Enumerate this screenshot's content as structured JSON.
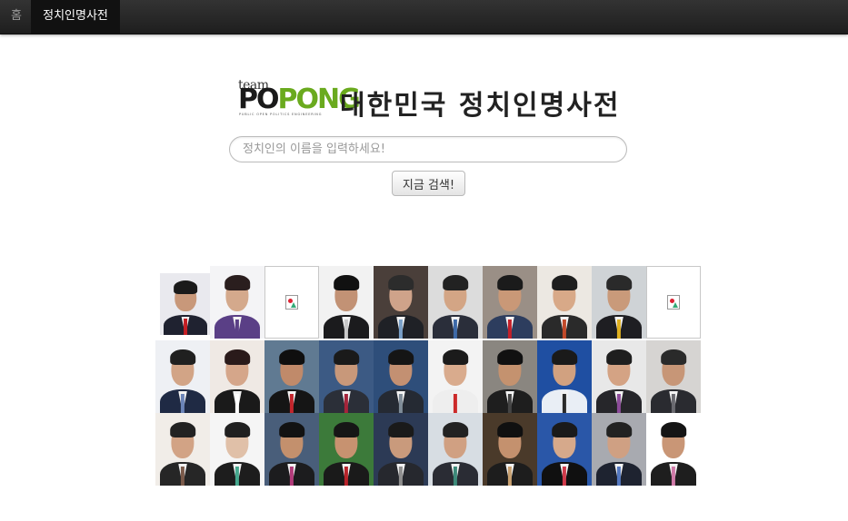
{
  "navbar": {
    "home_label": "홈",
    "active_label": "정치인명사전"
  },
  "brand": {
    "logo_team": "team",
    "logo_po": "PO",
    "logo_pong": "PONG",
    "logo_tagline": "PUBLIC OPEN POLITICS ENGINEERING",
    "title": "대한민국 정치인명사전"
  },
  "search": {
    "placeholder": "정치인의 이름을 입력하세요!",
    "value": "",
    "button_label": "지금 검색!"
  },
  "colors": {
    "navbar": "#222222",
    "logo_green": "#6aaa1e"
  },
  "photos": [
    {
      "bg": "#e9e9ee",
      "suit": "#1f2230",
      "tie": "#c41e24",
      "skin": "#c8987a",
      "hair": "#1a1a1a",
      "broken": false
    },
    {
      "bg": "#f4f4f6",
      "suit": "#5a3f86",
      "tie": "#5a3f86",
      "skin": "#d4a98c",
      "hair": "#2a1e1e",
      "broken": false
    },
    {
      "bg": "#ffffff",
      "suit": "",
      "tie": "",
      "skin": "",
      "hair": "",
      "broken": true
    },
    {
      "bg": "#f2f2f2",
      "suit": "#1b1b1d",
      "tie": "#c9c9c9",
      "skin": "#c29275",
      "hair": "#111111",
      "broken": false
    },
    {
      "bg": "#4a3f3a",
      "suit": "#1f2126",
      "tie": "#7aa0c8",
      "skin": "#cfa38a",
      "hair": "#2c2c2c",
      "broken": false
    },
    {
      "bg": "#dcdcdc",
      "suit": "#2a2e3a",
      "tie": "#3e6aa8",
      "skin": "#d3a585",
      "hair": "#222222",
      "broken": false
    },
    {
      "bg": "#9a8f86",
      "suit": "#2d3d5e",
      "tie": "#c4202a",
      "skin": "#c99877",
      "hair": "#1b1b1b",
      "broken": false
    },
    {
      "bg": "#ece8e2",
      "suit": "#2a2a2a",
      "tie": "#c24a2a",
      "skin": "#d8a988",
      "hair": "#1e1e1e",
      "broken": false
    },
    {
      "bg": "#cfd3d6",
      "suit": "#1e1e22",
      "tie": "#e0b11f",
      "skin": "#c99a7a",
      "hair": "#2a2a2a",
      "broken": false
    },
    {
      "bg": "#ffffff",
      "suit": "",
      "tie": "",
      "skin": "",
      "hair": "",
      "broken": true
    },
    {
      "bg": "#eef0f4",
      "suit": "#1f2a44",
      "tie": "#6b84b8",
      "skin": "#d2a486",
      "hair": "#202020",
      "broken": false
    },
    {
      "bg": "#efe9e4",
      "suit": "#1a1a1a",
      "tie": "#ffffff",
      "skin": "#d5a68a",
      "hair": "#2a1a1a",
      "broken": false
    },
    {
      "bg": "#607a92",
      "suit": "#151515",
      "tie": "#c3252c",
      "skin": "#c08a6a",
      "hair": "#0f0f0f",
      "broken": false
    },
    {
      "bg": "#3c5a84",
      "suit": "#2b2f38",
      "tie": "#a5243a",
      "skin": "#c8987a",
      "hair": "#1a1a1a",
      "broken": false
    },
    {
      "bg": "#2e4e7a",
      "suit": "#252a33",
      "tie": "#7f8c98",
      "skin": "#c39072",
      "hair": "#151515",
      "broken": false
    },
    {
      "bg": "#f3f3f3",
      "suit": "#eeeeee",
      "tie": "#cc2a2a",
      "skin": "#d9ab8d",
      "hair": "#1b1b1b",
      "broken": false
    },
    {
      "bg": "#8a8680",
      "suit": "#1e1e1e",
      "tie": "#444444",
      "skin": "#c4926f",
      "hair": "#111111",
      "broken": false
    },
    {
      "bg": "#1f4fa2",
      "suit": "#e9eef5",
      "tie": "#2a2a2a",
      "skin": "#d1a180",
      "hair": "#1a1a1a",
      "broken": false
    },
    {
      "bg": "#e8e8e8",
      "suit": "#26262a",
      "tie": "#8c4b9a",
      "skin": "#d4a384",
      "hair": "#1e1e1e",
      "broken": false
    },
    {
      "bg": "#d6d4d2",
      "suit": "#2a2b30",
      "tie": "#6a6a70",
      "skin": "#c79677",
      "hair": "#2a2a2a",
      "broken": false
    },
    {
      "bg": "#f1ede8",
      "suit": "#262626",
      "tie": "#7b5a4a",
      "skin": "#d2a385",
      "hair": "#222222",
      "broken": false
    },
    {
      "bg": "#f5f5f5",
      "suit": "#1d1d1d",
      "tie": "#45a88e",
      "skin": "#e0c0a8",
      "hair": "#202020",
      "broken": false
    },
    {
      "bg": "#495e7a",
      "suit": "#1c1c1e",
      "tie": "#b23b7a",
      "skin": "#c3906d",
      "hair": "#121212",
      "broken": false
    },
    {
      "bg": "#3c7a3a",
      "suit": "#1a1a1a",
      "tie": "#b8232a",
      "skin": "#c79270",
      "hair": "#161616",
      "broken": false
    },
    {
      "bg": "#2c3a55",
      "suit": "#26282e",
      "tie": "#8e8e8e",
      "skin": "#c99a7c",
      "hair": "#1a1a1a",
      "broken": false
    },
    {
      "bg": "#d7dde3",
      "suit": "#2a2c34",
      "tie": "#3d8a7a",
      "skin": "#d0a082",
      "hair": "#222222",
      "broken": false
    },
    {
      "bg": "#4a3a2a",
      "suit": "#1d1d1d",
      "tie": "#c8a070",
      "skin": "#c4916e",
      "hair": "#101010",
      "broken": false
    },
    {
      "bg": "#2a57a8",
      "suit": "#101010",
      "tie": "#d03a4a",
      "skin": "#d6a98b",
      "hair": "#1a1a1a",
      "broken": false
    },
    {
      "bg": "#a8aab0",
      "suit": "#1e2330",
      "tie": "#5478c0",
      "skin": "#cfa083",
      "hair": "#222222",
      "broken": false
    },
    {
      "bg": "#ffffff",
      "suit": "#1e1e1e",
      "tie": "#d07aa8",
      "skin": "#c99676",
      "hair": "#151515",
      "broken": false
    }
  ]
}
